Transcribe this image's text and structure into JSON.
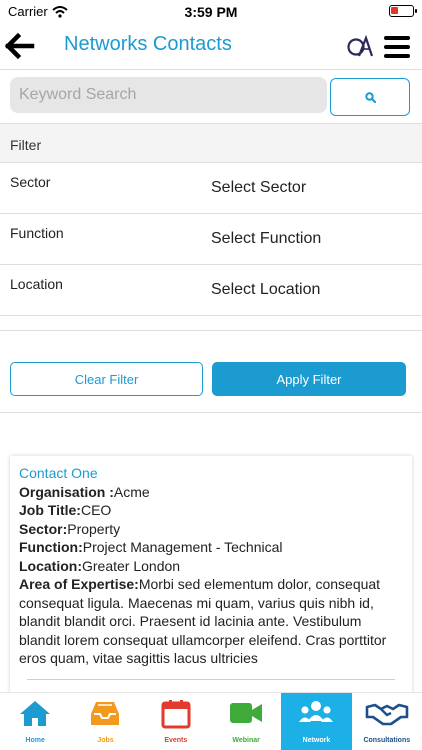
{
  "status_bar": {
    "carrier": "Carrier",
    "time": "3:59 PM"
  },
  "header": {
    "title": "Networks Contacts",
    "accent_color": "#1c9bd1"
  },
  "search": {
    "placeholder": "Keyword Search"
  },
  "filter": {
    "heading": "Filter",
    "rows": [
      {
        "label": "Sector",
        "value": "Select Sector"
      },
      {
        "label": "Function",
        "value": "Select Function"
      },
      {
        "label": "Location",
        "value": "Select Location"
      }
    ],
    "clear_label": "Clear Filter",
    "apply_label": "Apply Filter"
  },
  "contact": {
    "name": "Contact One",
    "organisation_label": "Organisation :",
    "organisation": "Acme",
    "job_title_label": "Job Title:",
    "job_title": "CEO",
    "sector_label": "Sector:",
    "sector": "Property",
    "function_label": "Function:",
    "function": "Project Management - Technical",
    "location_label": "Location:",
    "location": "Greater London",
    "expertise_label": "Area of Expertise:",
    "expertise": "Morbi sed elementum dolor, consequat consequat ligula. Maecenas mi quam, varius quis nibh id, blandit blandit orci. Praesent id lacinia ante. Vestibulum blandit lorem consequat ullamcorper eleifend. Cras porttitor eros quam, vitae sagittis lacus ultricies"
  },
  "tabs": [
    {
      "label": "Home",
      "icon": "home-icon",
      "color": "#1c9bd1"
    },
    {
      "label": "Jobs",
      "icon": "inbox-tray-icon",
      "color": "#f39a1e"
    },
    {
      "label": "Events",
      "icon": "calendar-icon",
      "color": "#e23b2e"
    },
    {
      "label": "Webinar",
      "icon": "video-camera-icon",
      "color": "#3daa3a"
    },
    {
      "label": "Network",
      "icon": "people-group-icon",
      "color": "#ffffff"
    },
    {
      "label": "Consultations",
      "icon": "handshake-icon",
      "color": "#1c4f8c"
    }
  ],
  "active_tab": "Network"
}
